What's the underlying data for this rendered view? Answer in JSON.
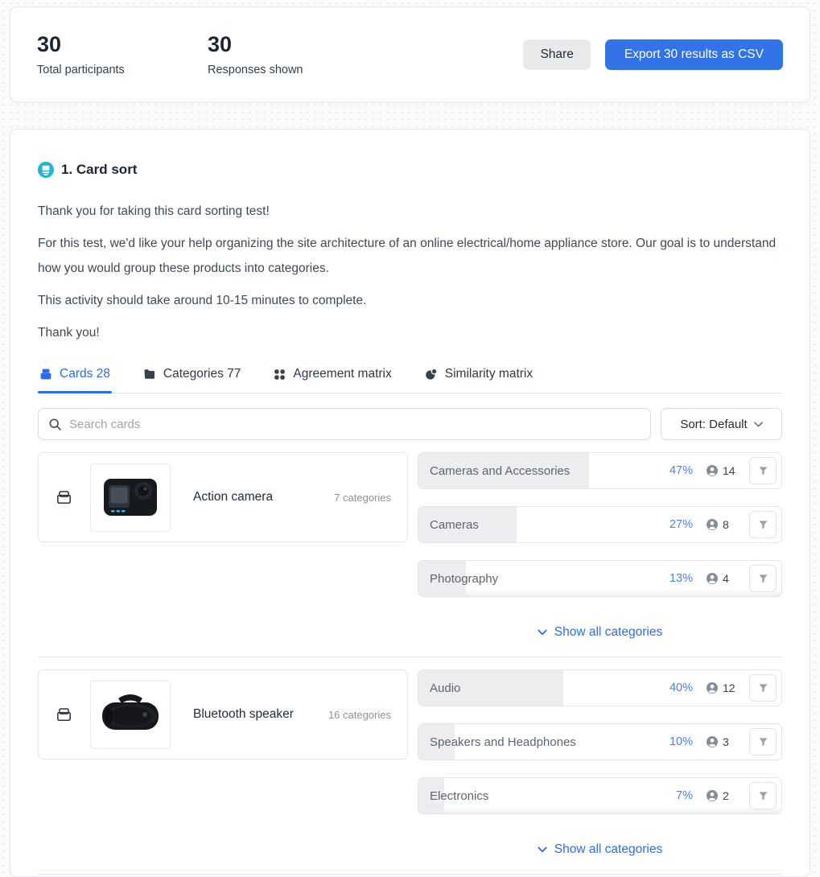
{
  "header": {
    "stats": [
      {
        "value": "30",
        "label": "Total participants"
      },
      {
        "value": "30",
        "label": "Responses shown"
      }
    ],
    "share_label": "Share",
    "export_label": "Export 30 results as CSV"
  },
  "section": {
    "title": "1. Card sort",
    "paragraphs": [
      "Thank you for taking this card sorting test!",
      "For this test, we'd like your help organizing the site architecture of an online electrical/home appliance store. Our goal is to understand how you would group these products into categories.",
      "This activity should take around 10-15 minutes to complete.",
      "Thank you!"
    ],
    "tabs": [
      {
        "label": "Cards 28",
        "icon": "cards-icon",
        "active": true
      },
      {
        "label": "Categories 77",
        "icon": "folder-icon",
        "active": false
      },
      {
        "label": "Agreement matrix",
        "icon": "agreement-matrix-icon",
        "active": false
      },
      {
        "label": "Similarity matrix",
        "icon": "similarity-matrix-icon",
        "active": false
      }
    ],
    "search_placeholder": "Search cards",
    "sort_label": "Sort: Default",
    "show_all_label": "Show all categories",
    "cards": [
      {
        "name": "Action camera",
        "image": "action-camera",
        "categories_count": "7 categories",
        "categories": [
          {
            "label": "Cameras and Accessories",
            "percent": "47%",
            "pct": 47,
            "count": "14"
          },
          {
            "label": "Cameras",
            "percent": "27%",
            "pct": 27,
            "count": "8"
          },
          {
            "label": "Photography",
            "percent": "13%",
            "pct": 13,
            "count": "4"
          }
        ]
      },
      {
        "name": "Bluetooth speaker",
        "image": "bluetooth-speaker",
        "categories_count": "16 categories",
        "categories": [
          {
            "label": "Audio",
            "percent": "40%",
            "pct": 40,
            "count": "12"
          },
          {
            "label": "Speakers and Headphones",
            "percent": "10%",
            "pct": 10,
            "count": "3"
          },
          {
            "label": "Electronics",
            "percent": "7%",
            "pct": 7,
            "count": "2"
          }
        ]
      }
    ]
  },
  "colors": {
    "accent_blue": "#2e6ce8",
    "percent_blue": "#4c82f1",
    "export_button": "#3273e8",
    "share_button": "#e8e9eb",
    "heading_icon_cyan": "#24b3d7",
    "bar_fill": "#ededf0"
  }
}
